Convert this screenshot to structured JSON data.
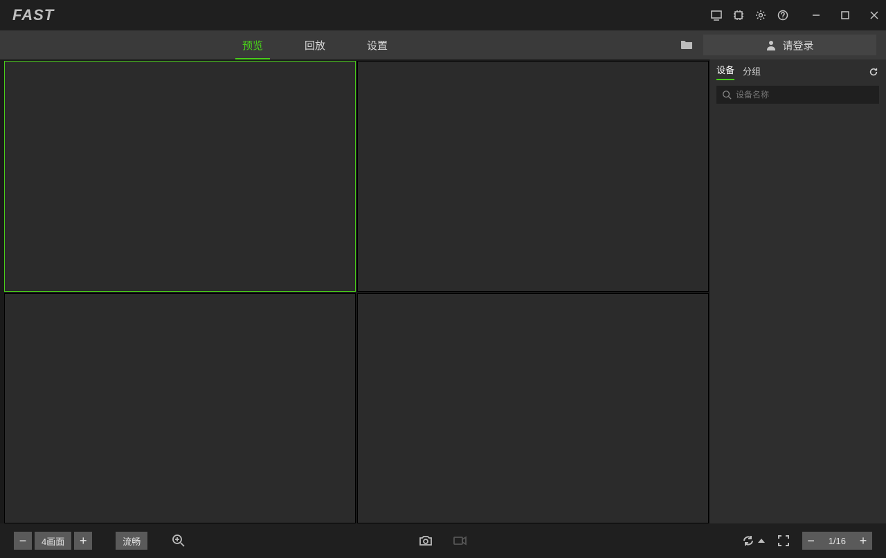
{
  "titlebar": {
    "logo": "FAST"
  },
  "tabs": {
    "preview": "预览",
    "playback": "回放",
    "settings": "设置"
  },
  "login": {
    "label": "请登录"
  },
  "side": {
    "tab_devices": "设备",
    "tab_groups": "分组",
    "search_placeholder": "设备名称"
  },
  "bottom": {
    "grid_label": "4画面",
    "quality": "流畅",
    "page_label": "1/16"
  }
}
